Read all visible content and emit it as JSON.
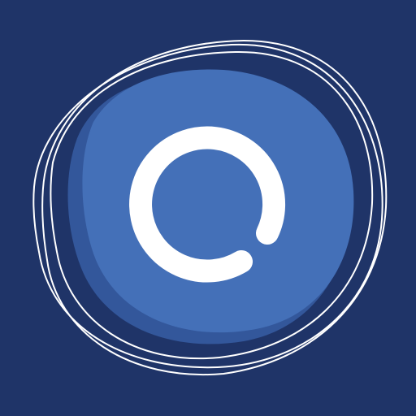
{
  "icon": {
    "name": "loading-ring-app-icon",
    "colors": {
      "background": "#1f3468",
      "shadow_disc": "#33579b",
      "main_disc": "#4470b8",
      "outline_strokes": "#ffffff",
      "ring_glyph": "#ffffff"
    }
  }
}
